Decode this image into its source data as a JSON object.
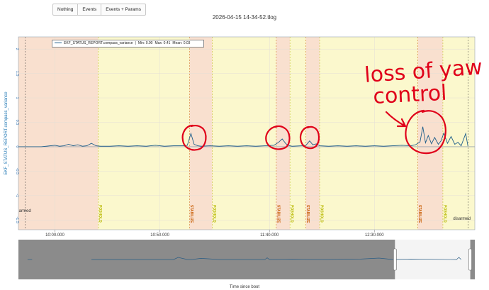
{
  "toolbar": {
    "buttons": [
      "Nothing",
      "Events",
      "Events + Params"
    ]
  },
  "window": {
    "title": "2026-04-15 14-34-52.tlog"
  },
  "chart_data": {
    "type": "line",
    "ylabel": "EKF_STATUS_REPORT.compass_variance",
    "xlabel": "Time since boot",
    "yticks": [
      "2",
      "1.5",
      "1",
      "0.5",
      "0",
      "-0.5",
      "-1",
      "-1.5"
    ],
    "ylim": [
      -1.7,
      2.25
    ],
    "xlim": [
      0,
      100
    ],
    "xticks": [
      {
        "label": "10:00.000",
        "x": 8
      },
      {
        "label": "10:50.000",
        "x": 31
      },
      {
        "label": "11:40.000",
        "x": 55
      },
      {
        "label": "12:30.000",
        "x": 78
      }
    ],
    "grid": true,
    "legend": {
      "series": "EKF_STATUS_REPORT.compass_variance",
      "min": "Min: 0.00",
      "max": "Max: 0.41",
      "mean": "Mean: 0.03"
    },
    "mode_regions": [
      {
        "from": 0,
        "to": 17.5,
        "mode": "orange"
      },
      {
        "from": 17.5,
        "to": 37.5,
        "mode": "yellow"
      },
      {
        "from": 37.5,
        "to": 42.5,
        "mode": "orange"
      },
      {
        "from": 42.5,
        "to": 56.5,
        "mode": "yellow"
      },
      {
        "from": 56.5,
        "to": 59.5,
        "mode": "orange"
      },
      {
        "from": 59.5,
        "to": 63.0,
        "mode": "yellow"
      },
      {
        "from": 63.0,
        "to": 66.0,
        "mode": "orange"
      },
      {
        "from": 66.0,
        "to": 87.5,
        "mode": "yellow"
      },
      {
        "from": 87.5,
        "to": 93.0,
        "mode": "orange"
      },
      {
        "from": 93.0,
        "to": 100,
        "mode": "yellow"
      }
    ],
    "events": [
      {
        "label": "armed",
        "x": 1.5,
        "color": "#333333",
        "side": "left"
      },
      {
        "label": "POSHOLD",
        "x": 17.5,
        "color": "#b8b800"
      },
      {
        "label": "STABILIZE",
        "x": 37.5,
        "color": "#c75b00"
      },
      {
        "label": "POSHOLD",
        "x": 42.5,
        "color": "#b8b800"
      },
      {
        "label": "STABILIZE",
        "x": 56.5,
        "color": "#c75b00"
      },
      {
        "label": "POSHOLD",
        "x": 59.5,
        "color": "#b8b800"
      },
      {
        "label": "STABILIZE",
        "x": 63.0,
        "color": "#c75b00"
      },
      {
        "label": "POSHOLD",
        "x": 66.0,
        "color": "#b8b800"
      },
      {
        "label": "STABILIZE",
        "x": 87.5,
        "color": "#c75b00"
      },
      {
        "label": "POSHOLD",
        "x": 93.0,
        "color": "#b8b800"
      },
      {
        "label": "disarmed",
        "x": 98.5,
        "color": "#333333",
        "side": "right"
      }
    ],
    "series": [
      {
        "name": "EKF_STATUS_REPORT.compass_variance",
        "color": "#1f5f8b",
        "x": [
          0,
          5,
          7,
          8,
          9,
          10,
          11,
          12,
          13,
          14,
          15,
          16,
          17,
          18,
          20,
          22,
          24,
          26,
          28,
          30,
          32,
          34,
          36,
          37,
          37.8,
          38.5,
          39.3,
          40,
          42,
          44,
          46,
          48,
          50,
          52,
          54,
          56,
          57,
          57.8,
          58.6,
          59.4,
          60,
          62,
          63,
          63.8,
          64.5,
          65.3,
          66,
          68,
          70,
          72,
          74,
          76,
          78,
          80,
          82,
          84,
          86,
          87,
          88,
          88.6,
          89.2,
          89.8,
          90.5,
          91.2,
          92,
          92.6,
          93.2,
          94,
          94.8,
          95.6,
          96.3,
          97,
          98,
          98.5
        ],
        "values": [
          0,
          0,
          0.02,
          0.03,
          0.01,
          0.02,
          0.05,
          0.02,
          0.04,
          0.01,
          0.02,
          0.07,
          0.02,
          0.01,
          0.01,
          0.02,
          0.01,
          0.02,
          0.01,
          0.03,
          0.01,
          0.02,
          0.02,
          0.03,
          0.27,
          0.05,
          0.02,
          0.01,
          0.02,
          0.01,
          0.02,
          0.01,
          0.02,
          0.01,
          0.02,
          0.03,
          0.09,
          0.16,
          0.06,
          0.02,
          0.01,
          0.02,
          0.03,
          0.12,
          0.04,
          0.06,
          0.02,
          0.01,
          0.02,
          0.01,
          0.02,
          0.01,
          0.02,
          0.01,
          0.02,
          0.03,
          0.02,
          0.04,
          0.1,
          0.41,
          0.08,
          0.23,
          0.06,
          0.19,
          0.05,
          0.12,
          0.28,
          0.07,
          0.21,
          0.05,
          0.09,
          0.02,
          0.27,
          0.01
        ]
      }
    ],
    "navigator": {
      "window": [
        82.5,
        99
      ],
      "series_x": [
        2,
        3,
        16,
        34,
        35,
        37,
        38,
        40,
        44,
        54,
        54.5,
        55,
        60,
        66,
        75,
        79,
        82,
        86,
        96,
        96.5,
        97
      ],
      "series_y": [
        0,
        0,
        0,
        0,
        0.15,
        0,
        0,
        0.08,
        0,
        0,
        0.12,
        0,
        0.02,
        0,
        0.03,
        0.1,
        0,
        0.03,
        0,
        0.15,
        0
      ]
    }
  },
  "annotation": {
    "line1": "loss of yaw",
    "line2": "control",
    "color": "#e0001a"
  }
}
